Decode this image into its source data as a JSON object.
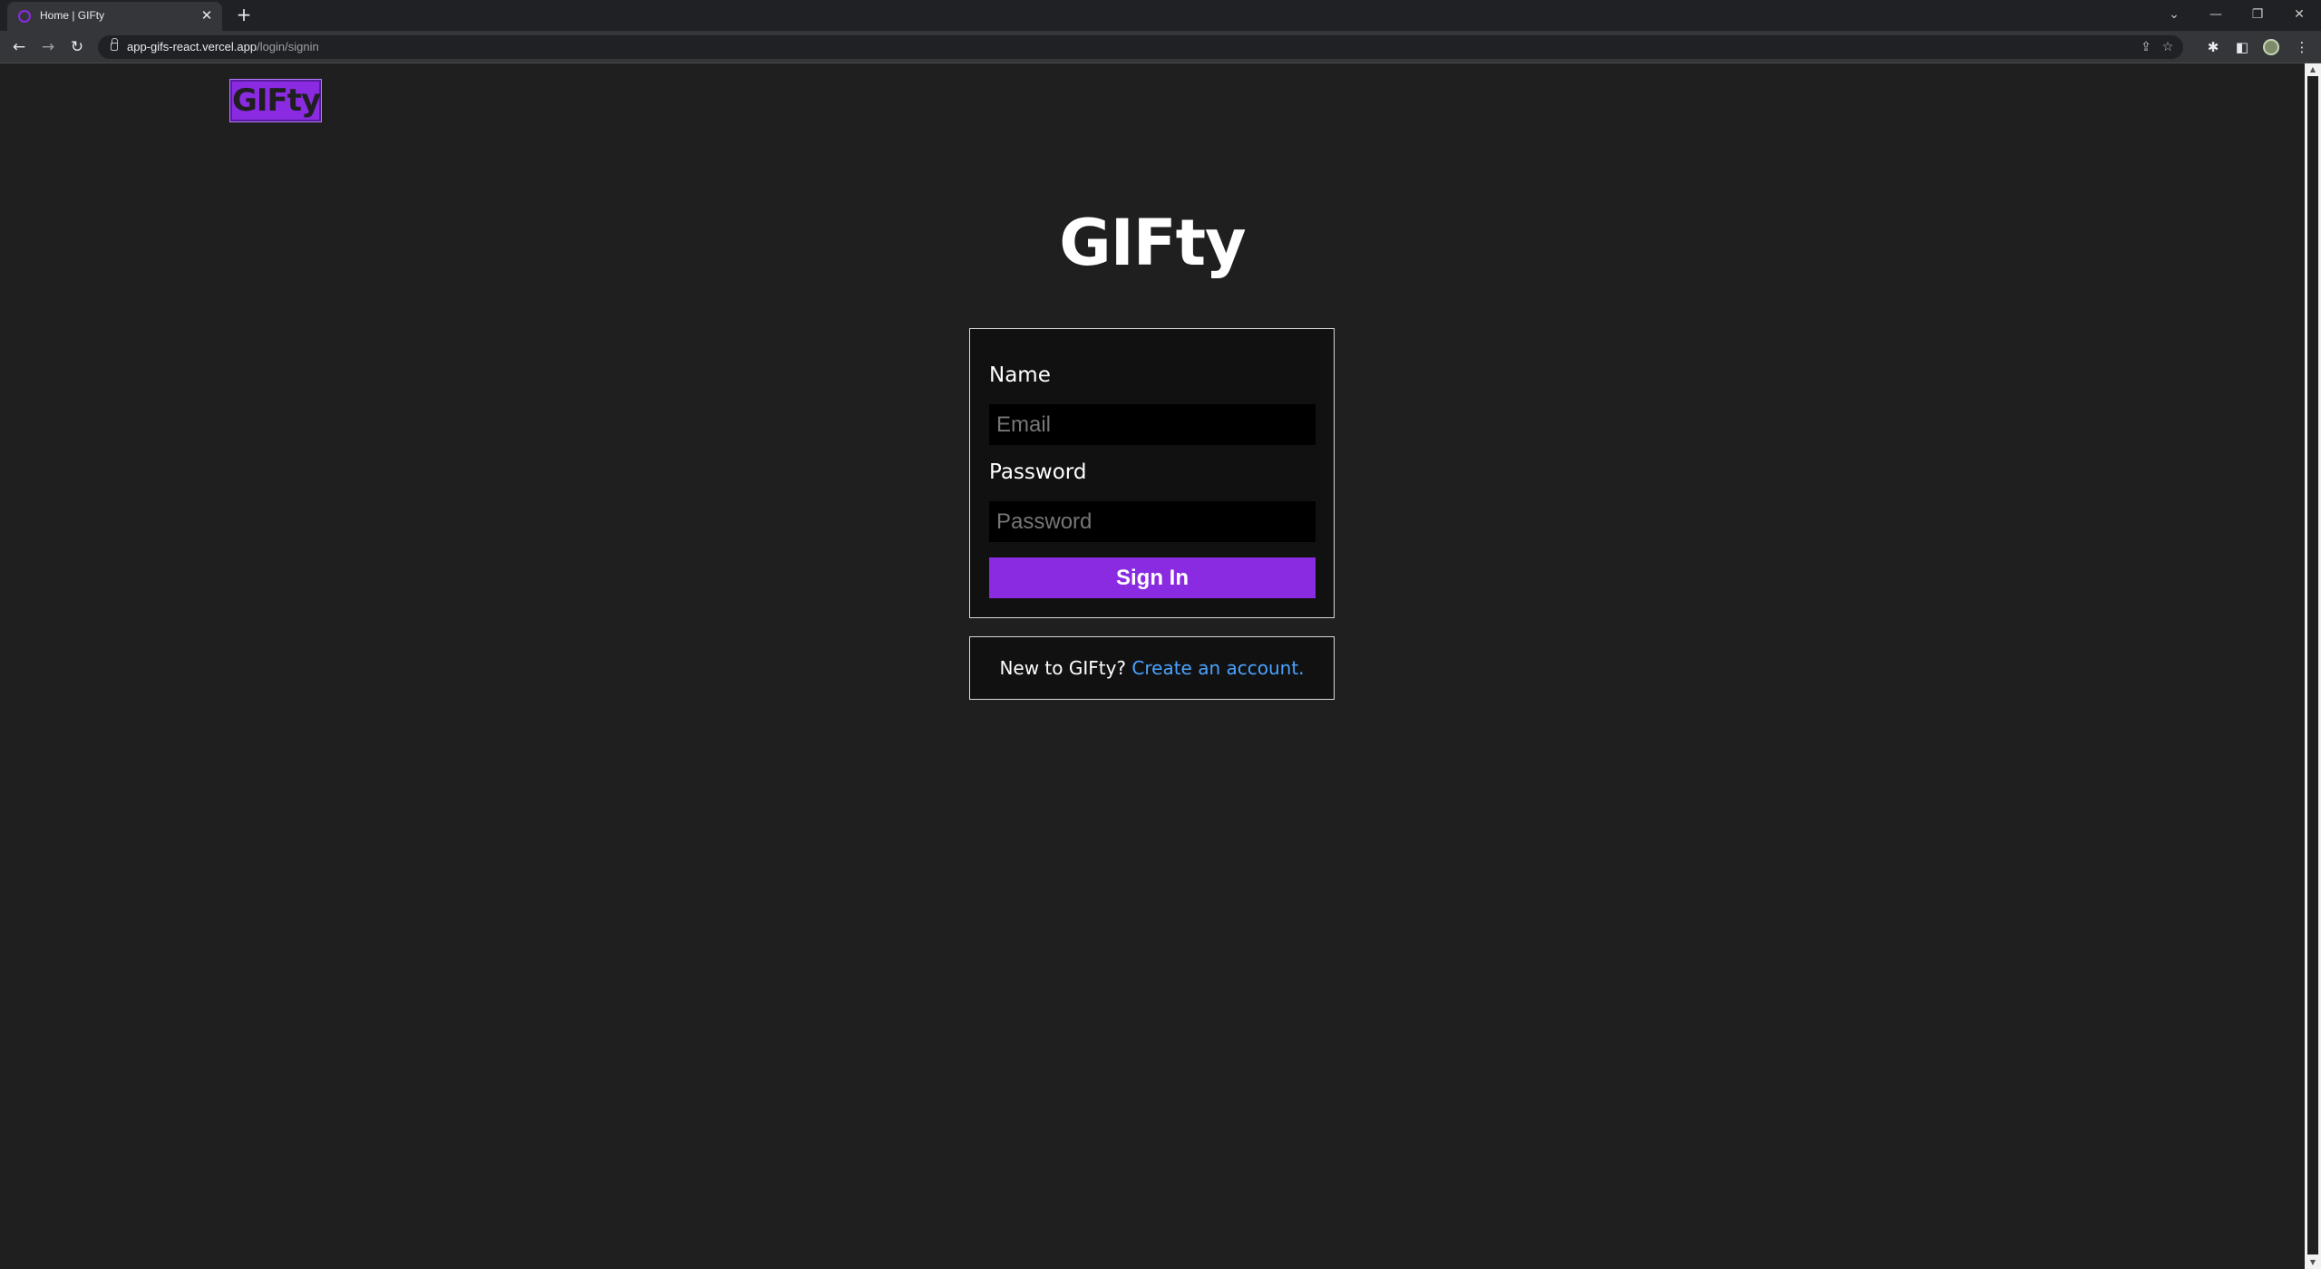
{
  "browser": {
    "tab_title": "Home | GIFty",
    "tab_close": "✕",
    "new_tab": "+",
    "url_host": "app-gifs-react.vercel.app",
    "url_path": "/login/signin",
    "controls": {
      "tab_list": "⌄",
      "minimize": "—",
      "restore": "❐",
      "close": "✕"
    },
    "nav": {
      "back": "←",
      "forward": "→",
      "reload": "↻"
    },
    "toolbar": {
      "share": "⇪",
      "bookmark": "☆",
      "extensions": "✱",
      "side_panel": "◧",
      "menu": "⋮"
    }
  },
  "page": {
    "logo": "GIFty",
    "title": "GIFty",
    "form": {
      "name_label": "Name",
      "email_placeholder": "Email",
      "password_label": "Password",
      "password_placeholder": "Password",
      "submit_label": "Sign In"
    },
    "signup": {
      "prompt": "New to GIFty? ",
      "link_label": "Create an account."
    }
  },
  "colors": {
    "background": "#1f1f1f",
    "accent": "#8a2be2",
    "link": "#4aa3ff",
    "card": "#111111"
  }
}
